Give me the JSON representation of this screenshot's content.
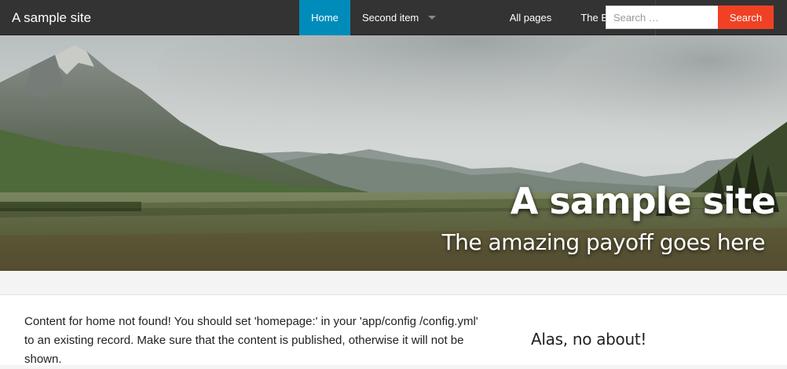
{
  "site": {
    "brand": "A sample site"
  },
  "nav": {
    "items": [
      {
        "label": "Home"
      },
      {
        "label": "Second item"
      },
      {
        "label": "All pages"
      },
      {
        "label": "The Bolt site"
      }
    ]
  },
  "search": {
    "placeholder": "Search …",
    "button_label": "Search"
  },
  "hero": {
    "title": "A sample site",
    "subtitle": "The amazing payoff goes here"
  },
  "content": {
    "message": "Content for home not found! You should set 'homepage:' in your 'app/config /config.yml' to an existing record. Make sure that the content is published, otherwise it will not be shown.",
    "aside_heading": "Alas, no about!"
  },
  "colors": {
    "topbar": "#333333",
    "active_nav": "#008cba",
    "search_button": "#f04124"
  }
}
